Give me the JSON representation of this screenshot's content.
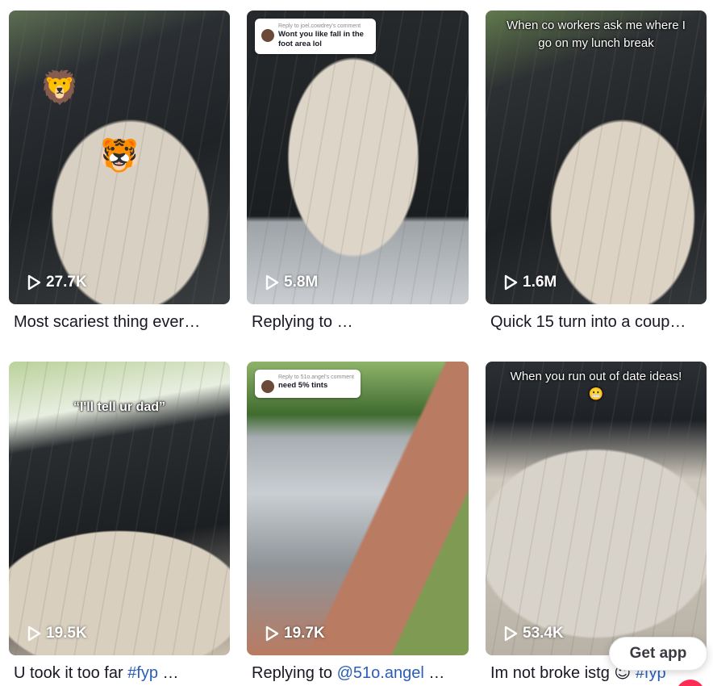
{
  "videos": [
    {
      "views": "27.7K",
      "overlay": "",
      "desc_text": "Most scariest thing ever…",
      "desc_tag": "",
      "emojis": [
        "🦁",
        "🐯"
      ]
    },
    {
      "views": "5.8M",
      "reply_meta": "Reply to joel.cowdrey's comment",
      "reply_text": "Wont you like fall in the foot area lol",
      "desc_text": "Replying to …",
      "desc_tag": ""
    },
    {
      "views": "1.6M",
      "overlay": "When co workers ask me where I go on my lunch break",
      "desc_text": "Quick 15 turn into a coup…",
      "desc_tag": ""
    },
    {
      "views": "19.5K",
      "overlay": "“I'll tell ur dad”",
      "desc_text": "U took it too far ",
      "desc_tag": "#fyp",
      "desc_suffix": " …"
    },
    {
      "views": "19.7K",
      "reply_meta": "Reply to 51o.angel's comment",
      "reply_text": "need 5% tints",
      "desc_text": "Replying to ",
      "desc_tag": "@51o.angel",
      "desc_suffix": " …"
    },
    {
      "views": "53.4K",
      "overlay": "When you run out of date ideas!😬",
      "desc_text": "Im not broke istg 😇 ",
      "desc_tag": "#fyp",
      "desc_suffix": ""
    }
  ],
  "get_app": {
    "label": "Get app"
  },
  "icons": {
    "play": "play-icon"
  },
  "colors": {
    "text": "#161823",
    "hashtag": "#2b5db9",
    "brand_red": "#fe2c55"
  }
}
